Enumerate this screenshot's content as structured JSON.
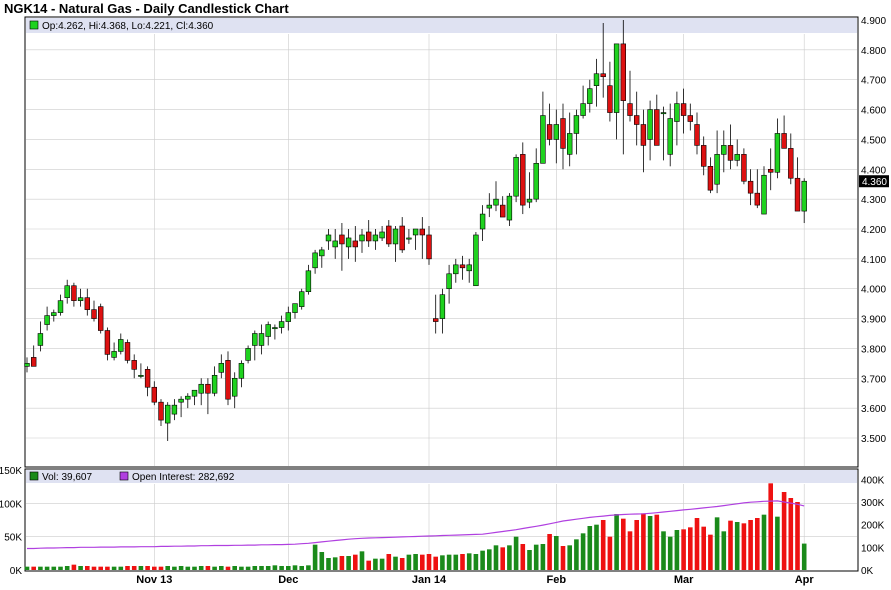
{
  "title": "NGK14 - Natural Gas - Daily Candlestick Chart",
  "legend": {
    "price": "Op:4.262, Hi:4.368, Lo:4.221, Cl:4.360",
    "volume": "Vol: 39,607",
    "open_interest": "Open Interest: 282,692"
  },
  "colors": {
    "up": "#1fd21f",
    "down": "#dd1111",
    "vol_up": "#1a8a1a",
    "vol_down": "#ee1111",
    "oi_line": "#b040e0",
    "grid": "#cccccc",
    "legend_band": "#dfe2f2"
  },
  "chart_data": [
    {
      "type": "candlestick",
      "ylim": [
        3.45,
        4.9
      ],
      "y_ticks": [
        "4.900",
        "4.800",
        "4.700",
        "4.600",
        "4.500",
        "4.400",
        "4.300",
        "4.200",
        "4.100",
        "4.000",
        "3.900",
        "3.800",
        "3.700",
        "3.600",
        "3.500"
      ],
      "x_ticks": [
        "Nov 13",
        "Dec",
        "Jan 14",
        "Feb",
        "Mar",
        "Apr"
      ],
      "last_price_label": "4.360",
      "grid": true,
      "series": [
        {
          "name": "Op",
          "values": [
            3.74,
            3.77,
            3.81,
            3.88,
            3.91,
            3.92,
            3.97,
            4.01,
            3.96,
            3.97,
            3.93,
            3.94,
            3.86,
            3.77,
            3.79,
            3.82,
            3.76,
            3.71,
            3.73,
            3.67,
            3.62,
            3.55,
            3.58,
            3.62,
            3.63,
            3.64,
            3.65,
            3.68,
            3.65,
            3.72,
            3.76,
            3.64,
            3.7,
            3.76,
            3.81,
            3.81,
            3.84,
            3.87,
            3.87,
            3.89,
            3.92,
            3.94,
            3.99,
            4.07,
            4.11,
            4.16,
            4.14,
            4.18,
            4.14,
            4.16,
            4.16,
            4.19,
            4.16,
            4.17,
            4.21,
            4.15,
            4.21,
            4.17,
            4.18,
            4.2,
            4.18,
            3.9,
            3.9,
            4.0,
            4.05,
            4.08,
            4.06,
            4.01,
            4.2,
            4.27,
            4.28,
            4.28,
            4.23,
            4.31,
            4.45,
            4.29,
            4.3,
            4.42,
            4.55,
            4.5,
            4.57,
            4.45,
            4.52,
            4.58,
            4.62,
            4.68,
            4.72,
            4.68,
            4.59,
            4.82,
            4.62,
            4.58,
            4.55,
            4.5,
            4.6,
            4.59,
            4.45,
            4.56,
            4.62,
            4.58,
            4.55,
            4.48,
            4.41,
            4.35,
            4.45,
            4.48,
            4.43,
            4.45,
            4.36,
            4.32,
            4.25,
            4.4,
            4.39,
            4.52,
            4.47,
            4.37,
            4.26
          ]
        },
        {
          "name": "Hi",
          "values": [
            3.77,
            3.81,
            3.89,
            3.94,
            3.93,
            3.98,
            4.03,
            4.02,
            4.0,
            4.0,
            3.96,
            3.95,
            3.87,
            3.82,
            3.85,
            3.83,
            3.78,
            3.75,
            3.74,
            3.69,
            3.63,
            3.62,
            3.63,
            3.64,
            3.65,
            3.66,
            3.7,
            3.7,
            3.74,
            3.78,
            3.79,
            3.72,
            3.76,
            3.81,
            3.86,
            3.88,
            3.89,
            3.88,
            3.91,
            3.94,
            3.95,
            4.0,
            4.08,
            4.13,
            4.14,
            4.2,
            4.2,
            4.22,
            4.2,
            4.21,
            4.2,
            4.23,
            4.2,
            4.21,
            4.23,
            4.21,
            4.24,
            4.2,
            4.2,
            4.24,
            4.21,
            3.98,
            4.0,
            4.08,
            4.1,
            4.11,
            4.1,
            4.19,
            4.28,
            4.32,
            4.36,
            4.31,
            4.32,
            4.45,
            4.49,
            4.39,
            4.47,
            4.66,
            4.62,
            4.6,
            4.62,
            4.59,
            4.6,
            4.68,
            4.7,
            4.77,
            4.89,
            4.76,
            4.78,
            4.9,
            4.73,
            4.66,
            4.6,
            4.63,
            4.65,
            4.61,
            4.62,
            4.66,
            4.67,
            4.62,
            4.59,
            4.51,
            4.44,
            4.53,
            4.53,
            4.55,
            4.5,
            4.47,
            4.4,
            4.4,
            4.41,
            4.47,
            4.57,
            4.58,
            4.52,
            4.44,
            4.37
          ]
        },
        {
          "name": "Lo",
          "values": [
            3.72,
            3.75,
            3.79,
            3.86,
            3.89,
            3.91,
            3.95,
            3.94,
            3.94,
            3.91,
            3.89,
            3.85,
            3.76,
            3.76,
            3.78,
            3.75,
            3.7,
            3.7,
            3.64,
            3.61,
            3.54,
            3.49,
            3.56,
            3.57,
            3.6,
            3.61,
            3.61,
            3.58,
            3.64,
            3.7,
            3.61,
            3.6,
            3.67,
            3.75,
            3.76,
            3.78,
            3.81,
            3.83,
            3.85,
            3.86,
            3.9,
            3.93,
            3.98,
            4.05,
            4.07,
            4.13,
            4.1,
            4.06,
            4.1,
            4.09,
            4.12,
            4.14,
            4.13,
            4.16,
            4.14,
            4.09,
            4.12,
            4.15,
            4.13,
            4.1,
            4.08,
            3.85,
            3.85,
            3.95,
            4.02,
            4.03,
            4.02,
            4.01,
            4.16,
            4.24,
            4.26,
            4.25,
            4.21,
            4.29,
            4.25,
            4.27,
            4.29,
            4.42,
            4.48,
            4.42,
            4.4,
            4.41,
            4.45,
            4.57,
            4.59,
            4.61,
            4.64,
            4.56,
            4.5,
            4.45,
            4.56,
            4.48,
            4.39,
            4.43,
            4.49,
            4.43,
            4.41,
            4.48,
            4.52,
            4.53,
            4.45,
            4.38,
            4.32,
            4.32,
            4.39,
            4.4,
            4.41,
            4.35,
            4.28,
            4.27,
            4.25,
            4.33,
            4.37,
            4.47,
            4.35,
            4.29,
            4.22
          ]
        },
        {
          "name": "Cl",
          "values": [
            3.75,
            3.74,
            3.85,
            3.91,
            3.92,
            3.96,
            4.01,
            3.96,
            3.97,
            3.93,
            3.9,
            3.86,
            3.78,
            3.79,
            3.83,
            3.76,
            3.73,
            3.71,
            3.67,
            3.62,
            3.56,
            3.61,
            3.61,
            3.63,
            3.64,
            3.66,
            3.68,
            3.65,
            3.71,
            3.75,
            3.63,
            3.7,
            3.75,
            3.8,
            3.85,
            3.85,
            3.88,
            3.87,
            3.89,
            3.92,
            3.95,
            3.99,
            4.06,
            4.12,
            4.13,
            4.18,
            4.16,
            4.15,
            4.17,
            4.14,
            4.18,
            4.16,
            4.18,
            4.19,
            4.15,
            4.2,
            4.13,
            4.17,
            4.2,
            4.18,
            4.1,
            3.89,
            3.98,
            4.05,
            4.08,
            4.07,
            4.08,
            4.18,
            4.25,
            4.28,
            4.3,
            4.24,
            4.31,
            4.44,
            4.28,
            4.3,
            4.42,
            4.58,
            4.5,
            4.55,
            4.47,
            4.52,
            4.58,
            4.62,
            4.67,
            4.72,
            4.71,
            4.59,
            4.82,
            4.63,
            4.58,
            4.55,
            4.48,
            4.6,
            4.48,
            4.59,
            4.57,
            4.62,
            4.58,
            4.56,
            4.48,
            4.41,
            4.33,
            4.45,
            4.48,
            4.43,
            4.45,
            4.36,
            4.32,
            4.28,
            4.38,
            4.39,
            4.52,
            4.47,
            4.37,
            4.26,
            4.36
          ]
        }
      ]
    },
    {
      "type": "bar",
      "ylim": [
        0,
        150000
      ],
      "y_ticks_left": [
        "150K",
        "100K",
        "50K",
        "0K"
      ],
      "y_ticks_right": [
        "400K",
        "300K",
        "200K",
        "100K",
        "0K"
      ],
      "series": [
        {
          "name": "Vol",
          "values": [
            5000,
            5000,
            5000,
            5000,
            5000,
            5000,
            6000,
            8000,
            6000,
            6000,
            5000,
            5000,
            5000,
            5000,
            5000,
            6000,
            6000,
            6000,
            6000,
            5000,
            5000,
            6000,
            5000,
            6000,
            5000,
            5000,
            6000,
            6000,
            5000,
            6000,
            5000,
            6000,
            5000,
            5000,
            6000,
            6000,
            6000,
            7000,
            6000,
            6000,
            7000,
            6000,
            7000,
            38000,
            27000,
            18000,
            19000,
            21000,
            21000,
            23000,
            28000,
            14000,
            17000,
            17000,
            24000,
            20000,
            18000,
            23000,
            24000,
            23000,
            24000,
            20000,
            22000,
            23000,
            23000,
            24000,
            25000,
            24000,
            29000,
            31000,
            37000,
            34000,
            37000,
            50000,
            39000,
            30000,
            38000,
            39000,
            54000,
            51000,
            36000,
            37000,
            46000,
            55000,
            66000,
            68000,
            75000,
            50000,
            84000,
            77000,
            58000,
            75000,
            85000,
            81000,
            83000,
            58000,
            50000,
            60000,
            61000,
            64000,
            78000,
            65000,
            53000,
            79000,
            58000,
            74000,
            72000,
            70000,
            75000,
            78000,
            83000,
            130000,
            80000,
            117000,
            108000,
            102000,
            39607
          ]
        },
        {
          "name": "Open Interest",
          "values": [
            95000,
            95000,
            96000,
            97000,
            97000,
            98000,
            99000,
            99000,
            100000,
            100000,
            100000,
            101000,
            101000,
            101000,
            102000,
            102000,
            102000,
            103000,
            103000,
            103000,
            104000,
            104000,
            105000,
            105000,
            106000,
            106000,
            107000,
            107000,
            108000,
            108000,
            108000,
            109000,
            109000,
            110000,
            110000,
            111000,
            111000,
            112000,
            112000,
            113000,
            114000,
            116000,
            118000,
            121000,
            124000,
            127000,
            130000,
            133000,
            136000,
            138000,
            140000,
            141000,
            142000,
            143000,
            144000,
            145000,
            146000,
            147000,
            148000,
            149000,
            150000,
            151000,
            152000,
            153000,
            154000,
            155000,
            156000,
            157000,
            158000,
            162000,
            166000,
            170000,
            174000,
            178000,
            183000,
            188000,
            193000,
            198000,
            204000,
            210000,
            216000,
            220000,
            224000,
            228000,
            232000,
            235000,
            238000,
            241000,
            243000,
            245000,
            246000,
            247000,
            248000,
            250000,
            253000,
            256000,
            259000,
            262000,
            265000,
            268000,
            271000,
            274000,
            277000,
            280000,
            284000,
            288000,
            292000,
            296000,
            299000,
            301000,
            303000,
            304000,
            305000,
            300000,
            295000,
            290000,
            282692
          ]
        }
      ]
    }
  ]
}
